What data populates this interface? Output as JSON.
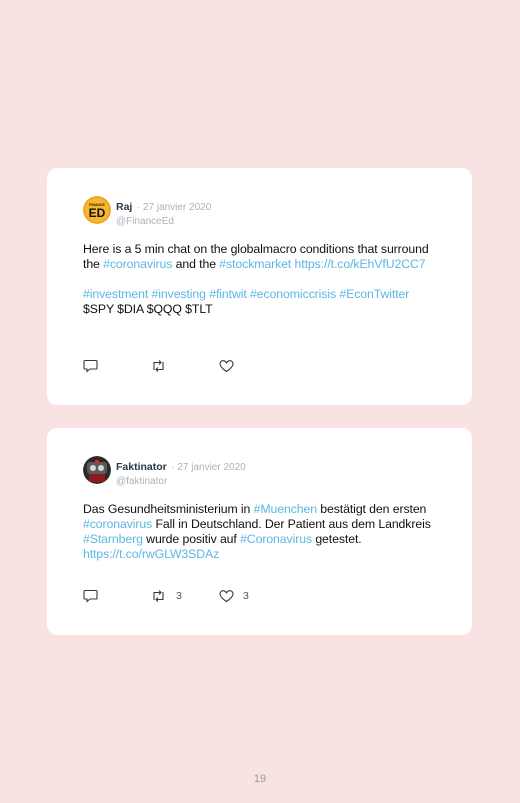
{
  "tweets": [
    {
      "name": "Raj",
      "date": "· 27 janvier 2020",
      "handle": "@FinanceEd",
      "avatar_text": "ED",
      "avatar_small": "FINANCE",
      "body": [
        {
          "t": "Here is a 5 min chat on the globalmacro conditions that surround the ",
          "link": false
        },
        {
          "t": "#coronavirus",
          "link": true
        },
        {
          "t": " and the ",
          "link": false
        },
        {
          "t": "#stockmarket",
          "link": true
        },
        {
          "t": " ",
          "link": false
        },
        {
          "t": "https://t.co/kEhVfU2CC7",
          "link": true
        },
        {
          "br": 2
        },
        {
          "t": "#investment",
          "link": true
        },
        {
          "t": " ",
          "link": false
        },
        {
          "t": "#investing",
          "link": true
        },
        {
          "t": " ",
          "link": false
        },
        {
          "t": "#fintwit",
          "link": true
        },
        {
          "t": " ",
          "link": false
        },
        {
          "t": "#economiccrisis",
          "link": true
        },
        {
          "t": " ",
          "link": false
        },
        {
          "t": "#EconTwitter",
          "link": true
        },
        {
          "t": " $SPY $DIA $QQQ $TLT",
          "link": false
        }
      ],
      "retweets": "",
      "likes": ""
    },
    {
      "name": "Faktinator",
      "date": "· 27 janvier 2020",
      "handle": "@faktinator",
      "body": [
        {
          "t": "Das Gesundheitsministerium in ",
          "link": false
        },
        {
          "t": "#Muenchen",
          "link": true
        },
        {
          "t": " bestätigt den ersten ",
          "link": false
        },
        {
          "t": "#coronavirus",
          "link": true
        },
        {
          "t": " Fall in Deutschland. Der Patient aus dem Landkreis ",
          "link": false
        },
        {
          "t": "#Starnberg",
          "link": true
        },
        {
          "t": " wurde positiv auf ",
          "link": false
        },
        {
          "t": "#Coronavirus",
          "link": true
        },
        {
          "t": " getestet. ",
          "link": false
        },
        {
          "t": "https://t.co/rwGLW3SDAz",
          "link": true
        }
      ],
      "retweets": "3",
      "likes": "3"
    }
  ],
  "page_number": "19",
  "colors": {
    "background": "#f8e2e2",
    "link": "#5bb7e4",
    "name": "#2b3a47",
    "muted": "#a9b3bb"
  },
  "icons": [
    "reply-icon",
    "retweet-icon",
    "like-icon"
  ]
}
